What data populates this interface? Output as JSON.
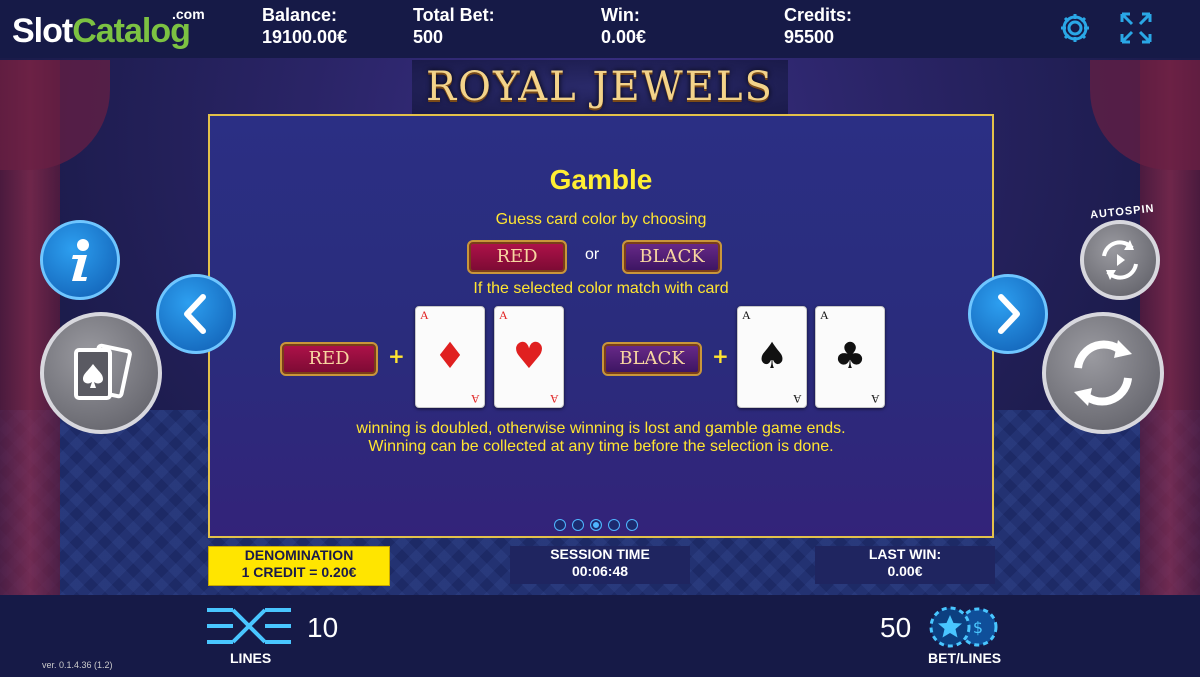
{
  "header": {
    "logo": {
      "slot": "Slot",
      "catalog": "Catalog",
      "com": ".com"
    },
    "balance": {
      "label": "Balance:",
      "value": "19100.00€"
    },
    "total_bet": {
      "label": "Total Bet:",
      "value": "500"
    },
    "win": {
      "label": "Win:",
      "value": "0.00€"
    },
    "credits": {
      "label": "Credits:",
      "value": "95500"
    },
    "icons": [
      "gear-icon",
      "fullscreen-icon"
    ]
  },
  "game_title": "ROYAL JEWELS",
  "panel": {
    "heading": "Gamble",
    "line1": "Guess card color by choosing",
    "red_label": "RED",
    "or_label": "or",
    "black_label": "BLACK",
    "line2": "If the selected color match with card",
    "plus": "+",
    "cards": [
      {
        "rank": "A",
        "suit": "♦",
        "color": "#e02020"
      },
      {
        "rank": "A",
        "suit": "♥",
        "color": "#e02020"
      },
      {
        "rank": "A",
        "suit": "♠",
        "color": "#111111"
      },
      {
        "rank": "A",
        "suit": "♣",
        "color": "#111111"
      }
    ],
    "line3": "winning is doubled, otherwise winning is lost and gamble game ends.",
    "line4": "Winning can be collected at any time before the selection is done.",
    "page_count": 5,
    "active_page": 3
  },
  "side": {
    "autospin_label": "AUTOSPIN"
  },
  "info": {
    "denom_label": "DENOMINATION",
    "denom_value": "1 CREDIT = 0.20€",
    "session_label": "SESSION TIME",
    "session_value": "00:06:48",
    "lastwin_label": "LAST WIN:",
    "lastwin_value": "0.00€"
  },
  "bottom": {
    "lines_value": "10",
    "lines_label": "LINES",
    "bet_value": "50",
    "bet_label": "BET/LINES",
    "version": "ver. 0.1.4.36 (1.2)"
  },
  "colors": {
    "accent_yellow": "#ffe531",
    "panel_border": "#e3c14a",
    "button_blue": "#1f7fd6"
  }
}
